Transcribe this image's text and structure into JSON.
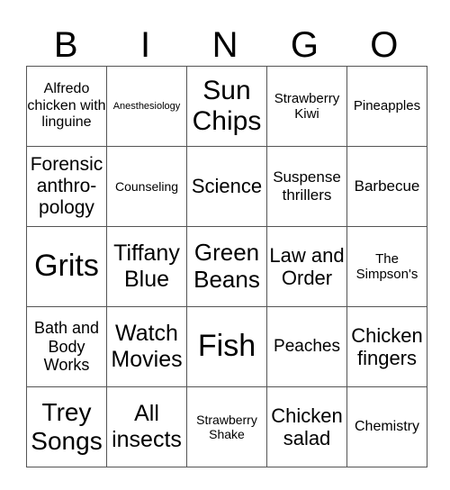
{
  "header": [
    "B",
    "I",
    "N",
    "G",
    "O"
  ],
  "rows": [
    [
      {
        "text": "Alfredo chicken with linguine",
        "size": 16
      },
      {
        "text": "Anesthesiology",
        "size": 11
      },
      {
        "text": "Sun Chips",
        "size": 30
      },
      {
        "text": "Strawberry Kiwi",
        "size": 15
      },
      {
        "text": "Pineapples",
        "size": 15
      }
    ],
    [
      {
        "text": "Forensic anthro-pology",
        "size": 21
      },
      {
        "text": "Counseling",
        "size": 14
      },
      {
        "text": "Science",
        "size": 22
      },
      {
        "text": "Suspense thrillers",
        "size": 17
      },
      {
        "text": "Barbecue",
        "size": 17
      }
    ],
    [
      {
        "text": "Grits",
        "size": 34
      },
      {
        "text": "Tiffany Blue",
        "size": 25
      },
      {
        "text": "Green Beans",
        "size": 26
      },
      {
        "text": "Law and Order",
        "size": 22
      },
      {
        "text": "The Simpson's",
        "size": 15
      }
    ],
    [
      {
        "text": "Bath and Body Works",
        "size": 18
      },
      {
        "text": "Watch Movies",
        "size": 25
      },
      {
        "text": "Fish",
        "size": 34
      },
      {
        "text": "Peaches",
        "size": 19
      },
      {
        "text": "Chicken fingers",
        "size": 22
      }
    ],
    [
      {
        "text": "Trey Songs",
        "size": 28
      },
      {
        "text": "All insects",
        "size": 25
      },
      {
        "text": "Strawberry Shake",
        "size": 14
      },
      {
        "text": "Chicken salad",
        "size": 22
      },
      {
        "text": "Chemistry",
        "size": 16
      }
    ]
  ]
}
